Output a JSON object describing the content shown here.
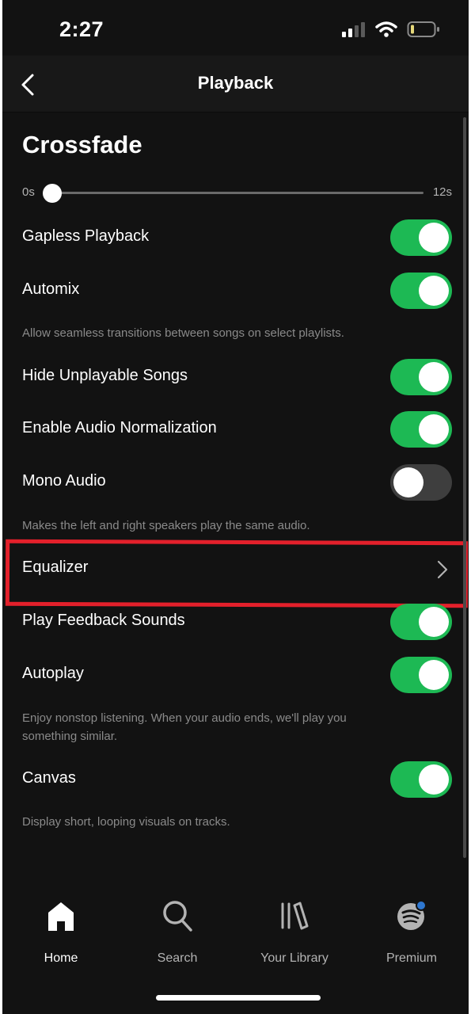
{
  "status_bar": {
    "time": "2:27",
    "icons": [
      "cellular-signal-icon",
      "wifi-icon",
      "battery-icon"
    ]
  },
  "header": {
    "title": "Playback",
    "back_icon": "chevron-left-icon"
  },
  "crossfade": {
    "title": "Crossfade",
    "min_label": "0s",
    "max_label": "12s",
    "value_fraction": 0.0
  },
  "settings": {
    "gapless": {
      "label": "Gapless Playback",
      "enabled": true
    },
    "automix": {
      "label": "Automix",
      "enabled": true,
      "description": "Allow seamless transitions between songs on select playlists."
    },
    "hide_unplayable": {
      "label": "Hide Unplayable Songs",
      "enabled": true
    },
    "normalization": {
      "label": "Enable Audio Normalization",
      "enabled": true
    },
    "mono": {
      "label": "Mono Audio",
      "enabled": false,
      "description": "Makes the left and right speakers play the same audio."
    },
    "equalizer": {
      "label": "Equalizer",
      "icon": "chevron-right-icon"
    },
    "feedback_sounds": {
      "label": "Play Feedback Sounds",
      "enabled": true
    },
    "autoplay": {
      "label": "Autoplay",
      "enabled": true,
      "description_line1": "Enjoy nonstop listening. When your audio ends, we'll play you",
      "description_line2": "something similar."
    },
    "canvas": {
      "label": "Canvas",
      "enabled": true,
      "description": "Display short, looping visuals on tracks."
    }
  },
  "nav": {
    "items": [
      {
        "label": "Home",
        "icon": "home-icon",
        "active": true
      },
      {
        "label": "Search",
        "icon": "search-icon",
        "active": false
      },
      {
        "label": "Your Library",
        "icon": "library-icon",
        "active": false
      },
      {
        "label": "Premium",
        "icon": "spotify-logo-icon",
        "active": false
      }
    ]
  },
  "colors": {
    "background": "#121212",
    "header_background": "#181818",
    "toggle_on": "#1db954",
    "toggle_off": "#3e3e3e",
    "highlight_border": "#e3202b",
    "description_text": "#8a8a8a",
    "notification_dot": "#2e77d0"
  }
}
